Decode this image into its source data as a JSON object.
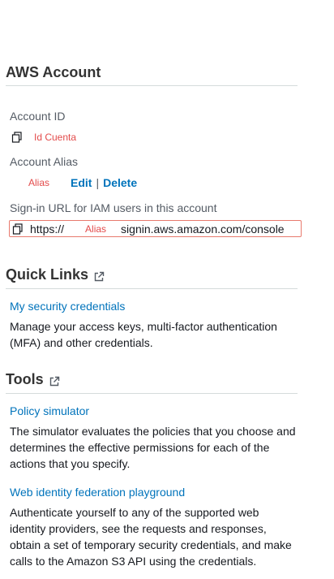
{
  "aws_account": {
    "title": "AWS Account",
    "account_id_label": "Account ID",
    "account_id_value": "Id Cuenta",
    "account_alias_label": "Account Alias",
    "alias_value": "Alias",
    "edit_label": "Edit",
    "separator": "|",
    "delete_label": "Delete",
    "signin_label": "Sign-in URL for IAM users in this account",
    "signin_url_prefix": "https://",
    "signin_url_alias": "Alias",
    "signin_url_suffix": "signin.aws.amazon.com/console"
  },
  "quick_links": {
    "title": "Quick Links",
    "items": [
      {
        "label": "My security credentials",
        "description": "Manage your access keys, multi-factor authentication (MFA) and other credentials."
      }
    ]
  },
  "tools": {
    "title": "Tools",
    "items": [
      {
        "label": "Policy simulator",
        "description": "The simulator evaluates the policies that you choose and determines the effective permissions for each of the actions that you specify."
      },
      {
        "label": "Web identity federation playground",
        "description": "Authenticate yourself to any of the supported web identity providers, see the requests and responses, obtain a set of temporary security credentials, and make calls to the Amazon S3 API using the credentials."
      }
    ]
  },
  "colors": {
    "link": "#0073bb",
    "redaction": "#e34b4b",
    "highlight_border": "#e87a6e"
  },
  "icons": [
    "copy-icon",
    "external-link-icon"
  ]
}
